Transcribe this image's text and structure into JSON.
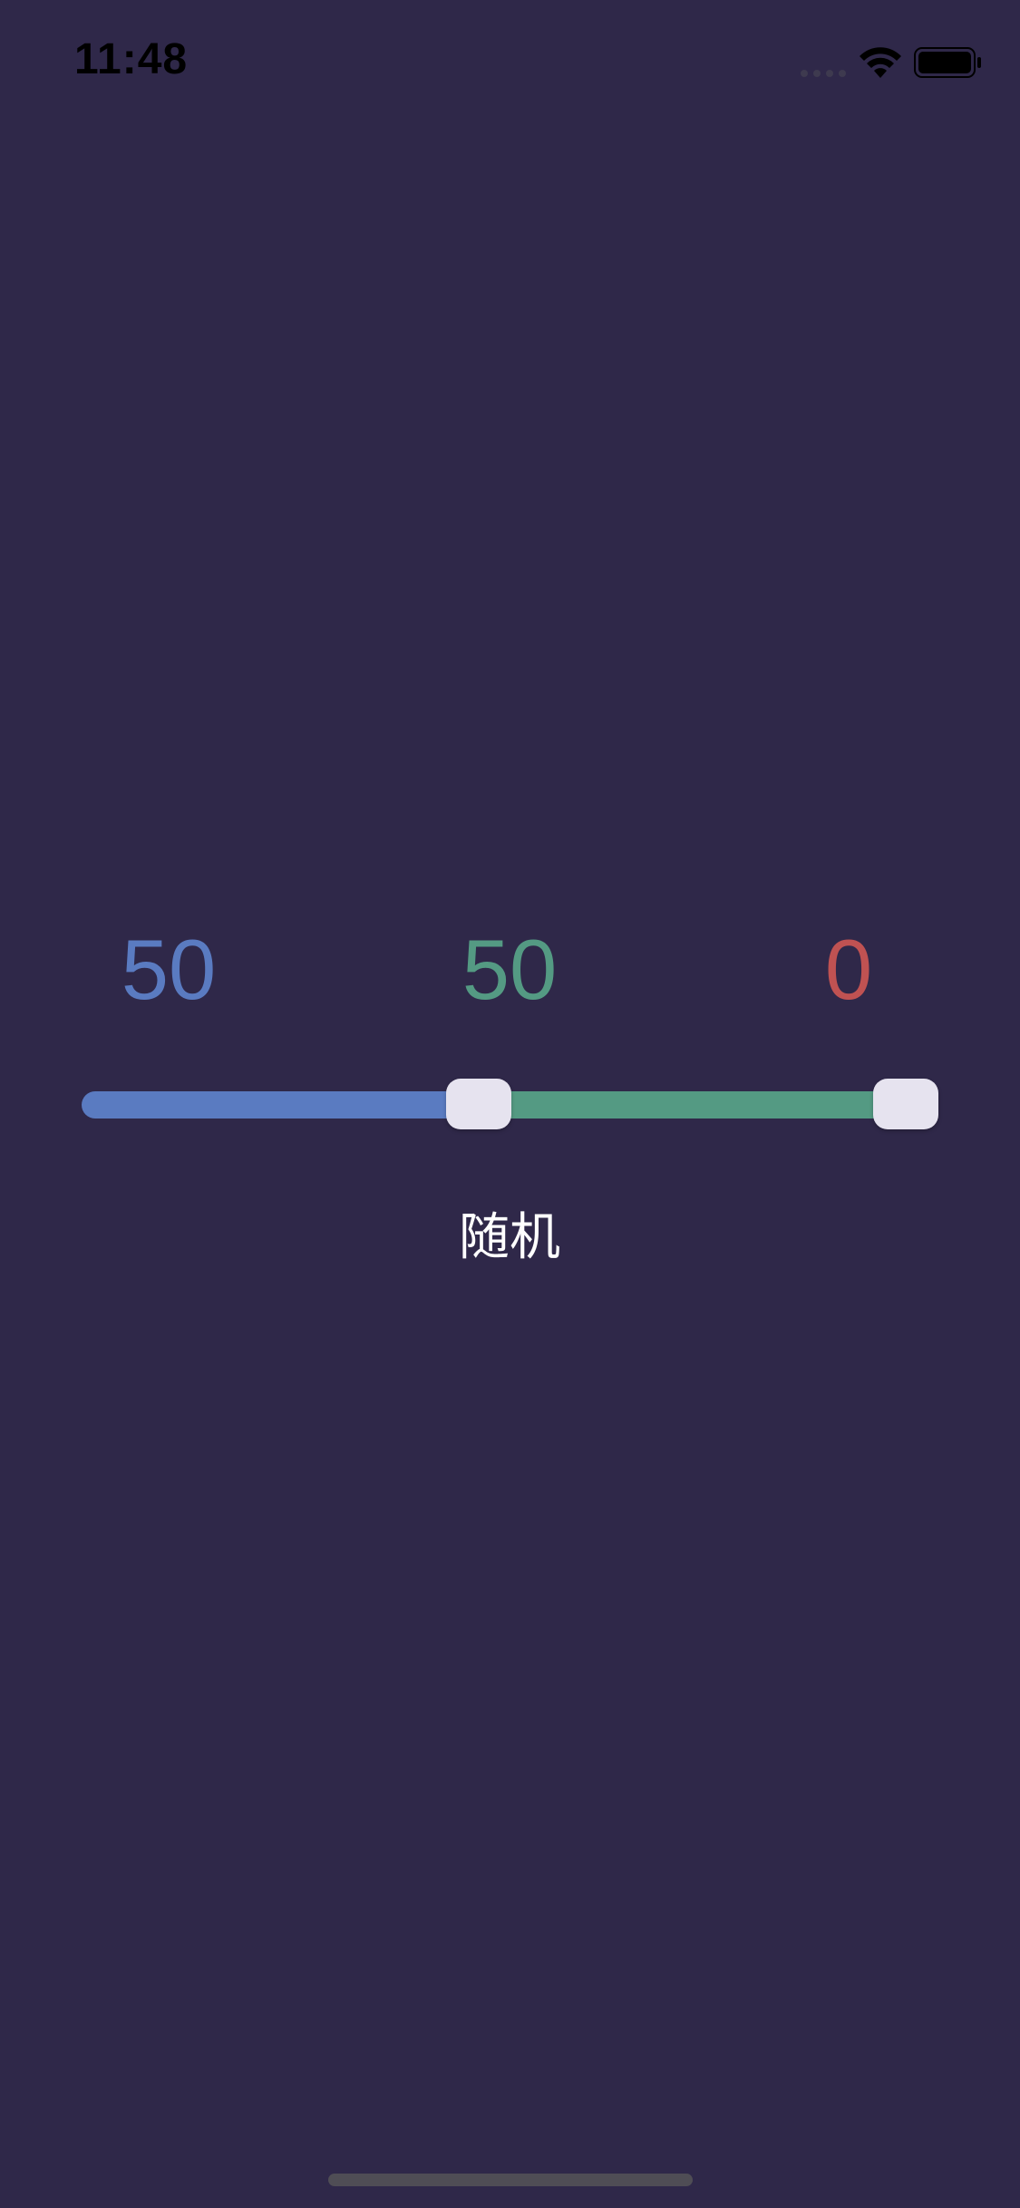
{
  "status_bar": {
    "time": "11:48"
  },
  "values": {
    "first": "50",
    "second": "50",
    "third": "0"
  },
  "slider": {
    "first_handle_fraction": 0.5,
    "second_handle_fraction": 1.0
  },
  "random_button_label": "随机",
  "icons": {
    "signal": "signal-dots-icon",
    "wifi": "wifi-icon",
    "battery": "battery-icon"
  },
  "colors": {
    "background": "#2f2849",
    "blue": "#5a7bc1",
    "green": "#549a83",
    "red": "#c05252",
    "thumb": "#e6e3ef"
  }
}
